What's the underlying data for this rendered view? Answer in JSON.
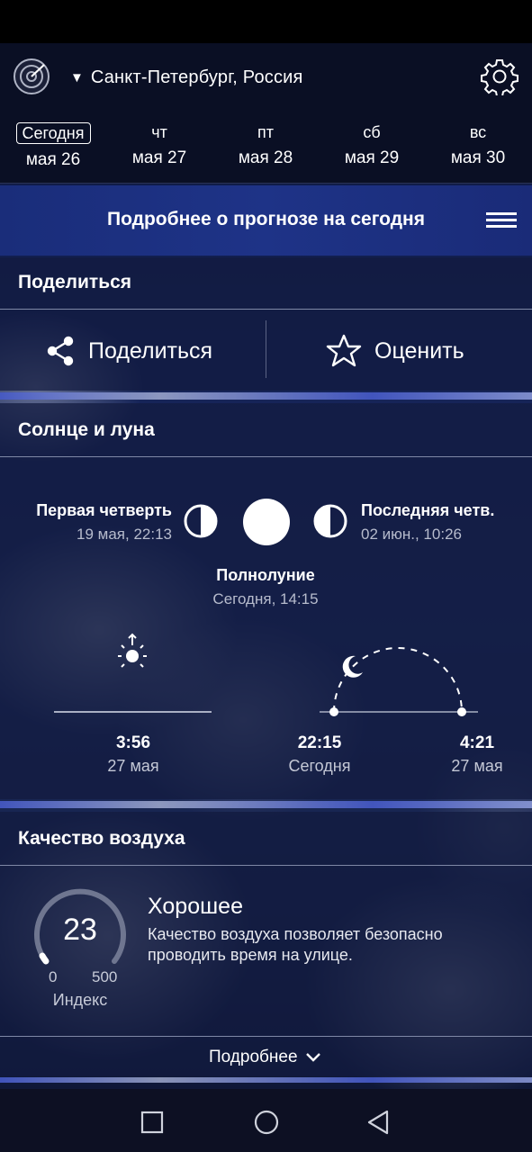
{
  "header": {
    "location": "Санкт-Петербург, Россия"
  },
  "days": [
    {
      "top": "Сегодня",
      "bottom": "мая 26",
      "active": true
    },
    {
      "top": "чт",
      "bottom": "мая 27"
    },
    {
      "top": "пт",
      "bottom": "мая 28"
    },
    {
      "top": "сб",
      "bottom": "мая 29"
    },
    {
      "top": "вс",
      "bottom": "мая 30"
    }
  ],
  "details": {
    "title": "Подробнее о прогнозе на сегодня"
  },
  "share": {
    "section_title": "Поделиться",
    "share_label": "Поделиться",
    "rate_label": "Оценить"
  },
  "sun_moon": {
    "section_title": "Солнце и луна",
    "first_quarter": {
      "label": "Первая четверть",
      "date": "19 мая, 22:13"
    },
    "last_quarter": {
      "label": "Последняя четв.",
      "date": "02 июн., 10:26"
    },
    "full_moon": {
      "label": "Полнолуние",
      "date": "Сегодня, 14:15"
    },
    "sun": {
      "time": "3:56",
      "date": "27 мая"
    },
    "moonrise": {
      "time": "22:15",
      "date": "Сегодня"
    },
    "moonset": {
      "time": "4:21",
      "date": "27 мая"
    }
  },
  "air_quality": {
    "section_title": "Качество воздуха",
    "value": "23",
    "min": "0",
    "max": "500",
    "index_label": "Индекс",
    "status": "Хорошее",
    "description": "Качество воздуха позволяет безопасно проводить время на улице.",
    "more_label": "Подробнее"
  },
  "colors": {
    "accent": "#1e3387",
    "background": "#142257",
    "header": "#0a0f24"
  },
  "icons": [
    "radar-icon",
    "gear-icon",
    "menu-icon",
    "share-icon",
    "star-icon",
    "sunrise-icon",
    "moon-icon",
    "chevron-down-icon"
  ]
}
